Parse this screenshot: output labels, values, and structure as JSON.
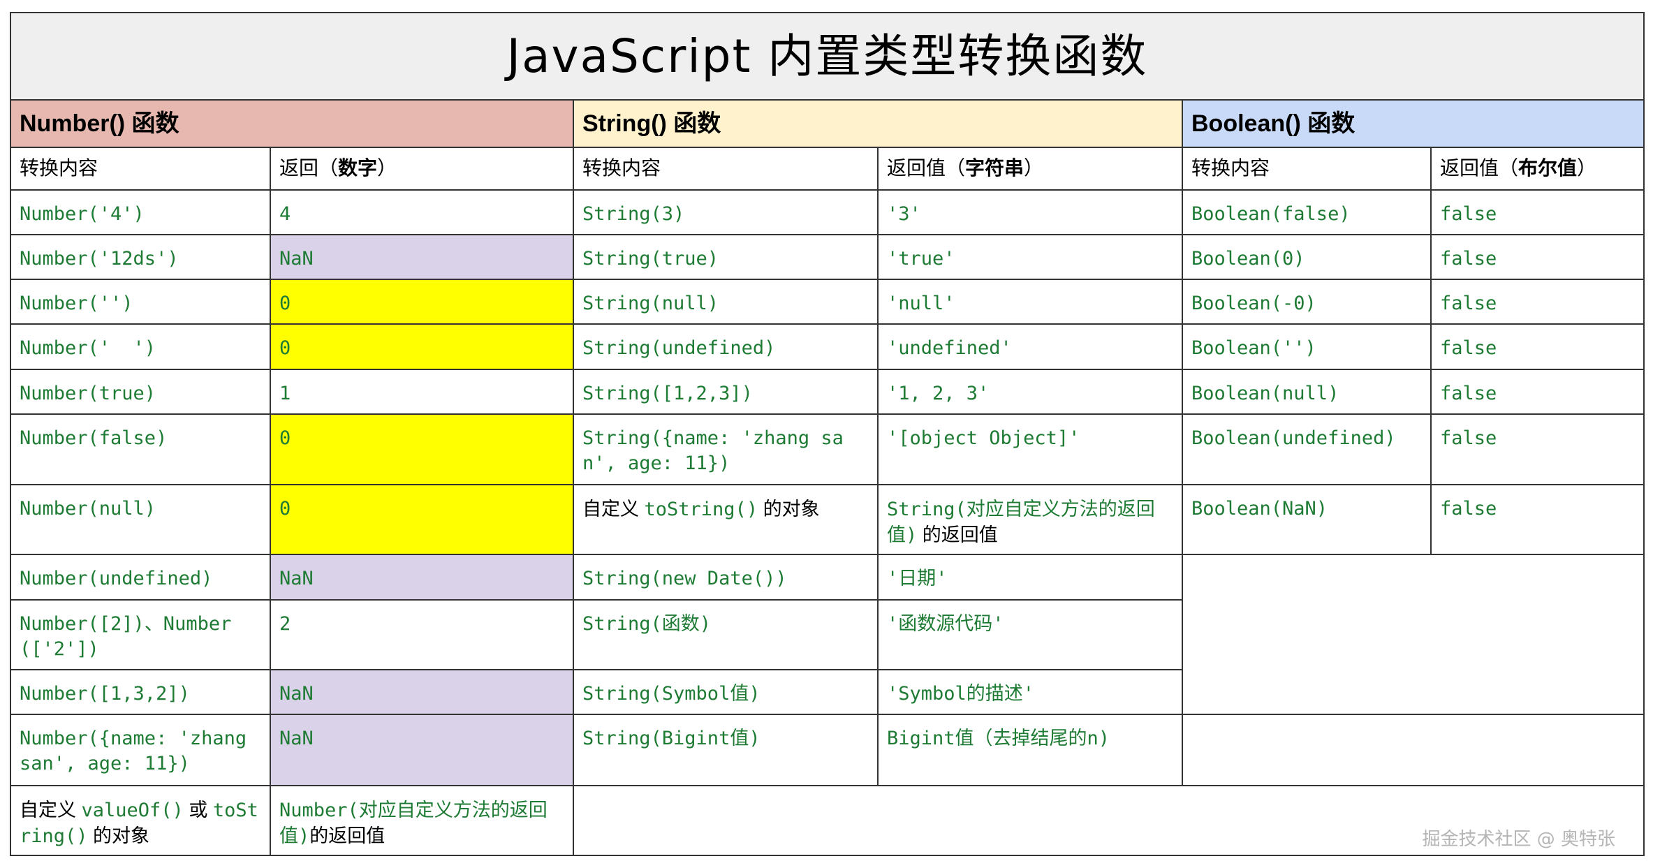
{
  "title": "JavaScript 内置类型转换函数",
  "sections": {
    "number": {
      "label": "Number() 函数",
      "col_input": "转换内容",
      "col_result_prefix": "返回（",
      "col_result_bold": "数字",
      "col_result_suffix": "）"
    },
    "string": {
      "label": "String() 函数",
      "col_input": "转换内容",
      "col_result_prefix": "返回值（",
      "col_result_bold": "字符串",
      "col_result_suffix": "）"
    },
    "boolean": {
      "label": "Boolean() 函数",
      "col_input": "转换内容",
      "col_result_prefix": "返回值（",
      "col_result_bold": "布尔值",
      "col_result_suffix": "）"
    }
  },
  "colors": {
    "title_bg": "#efefef",
    "number_bg": "#e6b8af",
    "string_bg": "#fff2cc",
    "boolean_bg": "#c9daf8",
    "nan_bg": "#d9d2e9",
    "zero_bg": "#ffff00",
    "code": "#1e7b34"
  },
  "rows": [
    {
      "n_in": "Number('4')",
      "n_out": "4",
      "s_in": "String(3)",
      "s_out": "'3'",
      "b_in": "Boolean(false)",
      "b_out": "false"
    },
    {
      "n_in": "Number('12ds')",
      "n_out": "NaN",
      "s_in": "String(true)",
      "s_out": "'true'",
      "b_in": "Boolean(0)",
      "b_out": "false"
    },
    {
      "n_in": "Number('')",
      "n_out": "0",
      "s_in": "String(null)",
      "s_out": "'null'",
      "b_in": "Boolean(-0)",
      "b_out": "false"
    },
    {
      "n_in": "Number('  ')",
      "n_out": "0",
      "s_in": "String(undefined)",
      "s_out": "'undefined'",
      "b_in": "Boolean('')",
      "b_out": "false"
    },
    {
      "n_in": "Number(true)",
      "n_out": "1",
      "s_in": "String([1,2,3])",
      "s_out": "'1, 2, 3'",
      "b_in": "Boolean(null)",
      "b_out": "false"
    },
    {
      "n_in": "Number(false)",
      "n_out": "0",
      "s_in": "String({name: 'zhang san', age: 11})",
      "s_out": "'[object Object]'",
      "b_in": "Boolean(undefined)",
      "b_out": "false"
    },
    {
      "n_in": "Number(null)",
      "n_out": "0",
      "s_in_pre": "自定义 ",
      "s_in_code": "toString()",
      "s_in_post": " 的对象",
      "s_out_code": "String(对应自定义方法的返回值)",
      "s_out_post": " 的返回值",
      "b_in": "Boolean(NaN)",
      "b_out": "false"
    },
    {
      "n_in": "Number(undefined)",
      "n_out": "NaN",
      "s_in": "String(new Date())",
      "s_out": "'日期'"
    },
    {
      "n_in": "Number([2])、Number(['2'])",
      "n_out": "2",
      "s_in": "String(函数)",
      "s_out": "'函数源代码'"
    },
    {
      "n_in": "Number([1,3,2])",
      "n_out": "NaN",
      "s_in": "String(Symbol值)",
      "s_out": "'Symbol的描述'"
    },
    {
      "n_in": "Number({name: 'zhang san', age: 11})",
      "n_out": "NaN",
      "s_in": "String(Bigint值)",
      "s_out": "Bigint值（去掉结尾的n)"
    },
    {
      "n_in_pre": "自定义 ",
      "n_in_code1": "valueOf()",
      "n_in_mid": " 或 ",
      "n_in_code2": "toString()",
      "n_in_post": " 的对象",
      "n_out_code": "Number(对应自定义方法的返回值)",
      "n_out_post": "的返回值"
    }
  ],
  "watermark": "掘金技术社区 @ 奥特张"
}
